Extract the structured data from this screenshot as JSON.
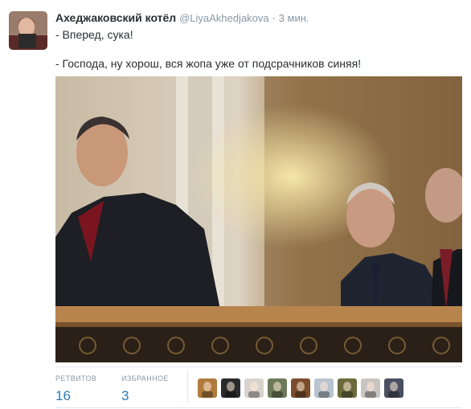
{
  "tweet": {
    "fullname": "Ахеджаковский котёл",
    "username": "@LiyaAkhedjakova",
    "separator": "·",
    "time": "3 мин.",
    "line1": "- Вперед, сука!",
    "line2": "- Господа, ну хорош, вся жопа уже от подсрачников синяя!"
  },
  "stats": {
    "retweets_label": "РЕТВИТОВ",
    "retweets_value": "16",
    "favorites_label": "ИЗБРАННОЕ",
    "favorites_value": "3"
  },
  "favoriters": [
    {
      "icon": "avatar-icon",
      "color": "#b07b3c"
    },
    {
      "icon": "avatar-icon",
      "color": "#2a2a2a"
    },
    {
      "icon": "avatar-icon",
      "color": "#d9d3cf"
    },
    {
      "icon": "avatar-icon",
      "color": "#6d7a5a"
    },
    {
      "icon": "avatar-icon",
      "color": "#7b4d2c"
    },
    {
      "icon": "avatar-icon",
      "color": "#b8c4cf"
    },
    {
      "icon": "avatar-icon",
      "color": "#6c6a3c"
    },
    {
      "icon": "avatar-icon",
      "color": "#c9c3c1"
    },
    {
      "icon": "avatar-icon",
      "color": "#4a5060"
    }
  ]
}
